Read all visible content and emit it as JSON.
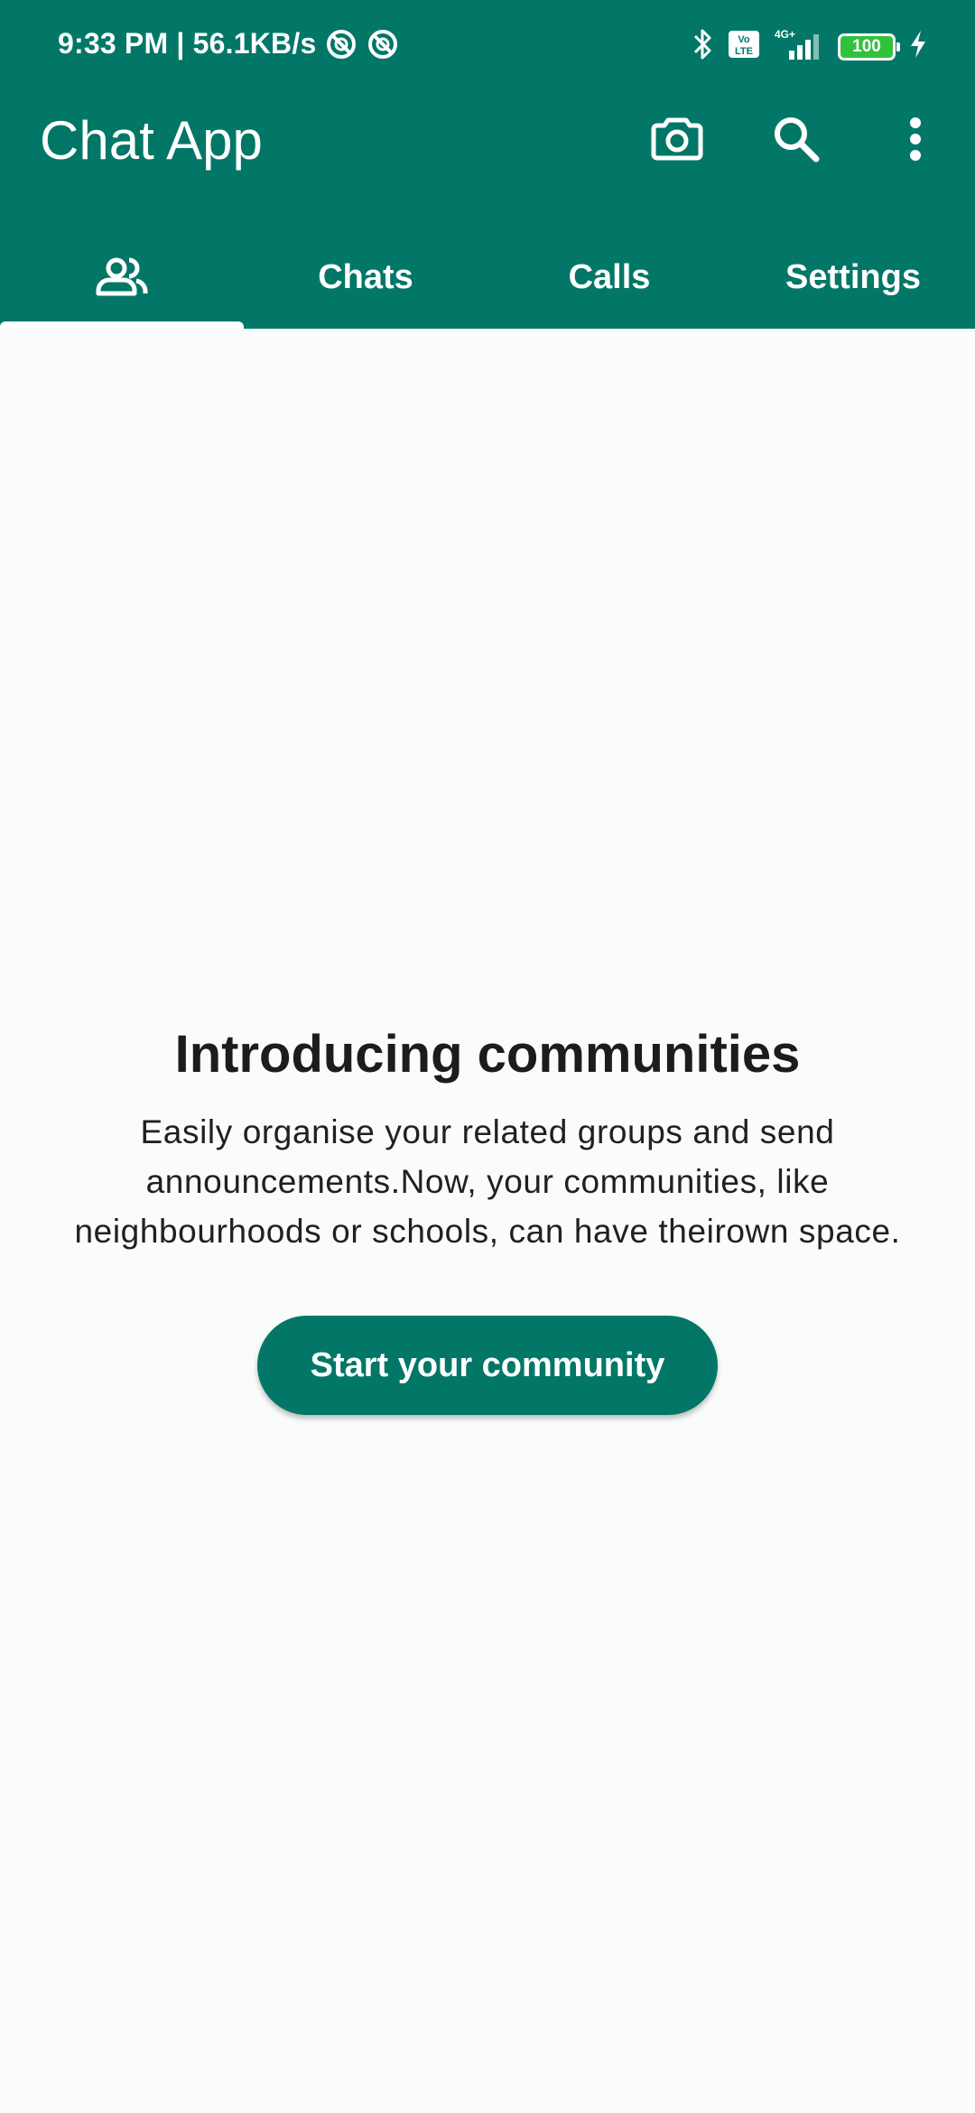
{
  "status_bar": {
    "time_speed": "9:33 PM | 56.1KB/s",
    "network": "4G+",
    "volte": "Vo LTE",
    "battery": "100"
  },
  "app_bar": {
    "title": "Chat App",
    "icons": [
      "camera-icon",
      "search-icon",
      "more-vert-icon"
    ]
  },
  "tabs": [
    {
      "icon": "communities-icon",
      "label": "",
      "selected": true
    },
    {
      "label": "Chats"
    },
    {
      "label": "Calls"
    },
    {
      "label": "Settings"
    }
  ],
  "intro": {
    "title": "Introducing communities",
    "text": "Easily organise your related groups and send announcements.Now, your communities, like neighbourhoods or schools, can have theirown space."
  },
  "cta": {
    "label": "Start your community"
  },
  "colors": {
    "primary": "#027767",
    "background": "#fafcfc",
    "battery_fill": "#32c13c"
  }
}
